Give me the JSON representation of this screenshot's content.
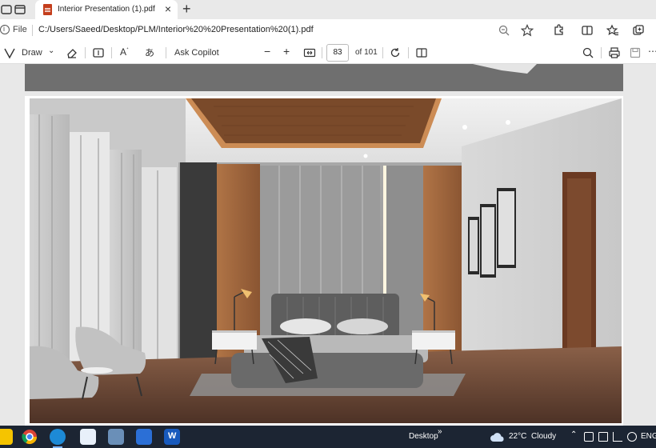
{
  "browser": {
    "tab": {
      "title": "Interior Presentation (1).pdf"
    },
    "address": {
      "scheme_label": "File",
      "url": "C:/Users/Saeed/Desktop/PLM/Interior%20%20Presentation%20(1).pdf"
    }
  },
  "pdf_toolbar": {
    "draw_label": "Draw",
    "copilot_label": "Ask Copilot",
    "page_current": "83",
    "page_total": "of 101"
  },
  "taskbar": {
    "desktop_label": "Desktop",
    "weather_temp": "22°C",
    "weather_desc": "Cloudy",
    "language": "ENG"
  },
  "icons": {
    "tab_actions": "tab-actions-icon",
    "vertical_tabs": "vertical-tabs-icon",
    "pdf_file": "pdf-file-icon",
    "close_tab": "close-tab-icon",
    "new_tab": "new-tab-icon",
    "info": "info-icon",
    "zoom": "zoom-icon",
    "favorite": "favorite-star-icon",
    "extensions": "extensions-icon",
    "split_screen": "split-screen-icon",
    "favorites": "favorites-icon",
    "collections": "collections-icon",
    "draw": "draw-icon",
    "erase": "erase-icon",
    "text": "text-box-icon",
    "read_aloud": "read-aloud-icon",
    "translate": "translate-icon",
    "zoom_out": "zoom-out-icon",
    "zoom_in": "zoom-in-icon",
    "fit_page": "fit-page-icon",
    "rotate": "rotate-icon",
    "page_view": "page-view-icon",
    "search": "search-icon",
    "print": "print-icon",
    "save": "save-icon"
  },
  "colors": {
    "tab_strip": "#e9e9e9",
    "pdf_red": "#c43e1c",
    "taskbar": "#1c2533",
    "ceiling_wood": "#8a5a34",
    "wall_grey": "#9a9a9a"
  }
}
